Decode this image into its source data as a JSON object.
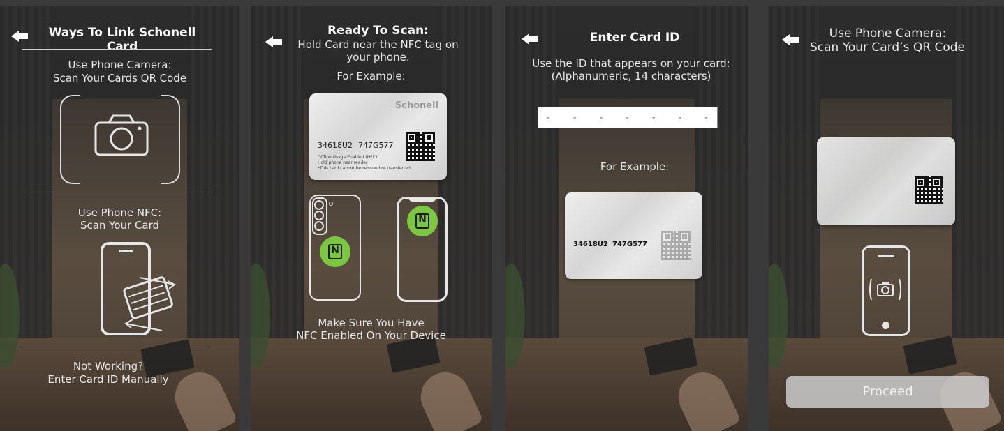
{
  "panel1": {
    "title": "Ways To Link Schonell Card",
    "camera_line1": "Use Phone Camera:",
    "camera_line2": "Scan Your Cards QR Code",
    "nfc_line1": "Use Phone NFC:",
    "nfc_line2": "Scan Your Card",
    "manual_line1": "Not Working?",
    "manual_line2": "Enter Card ID Manually"
  },
  "panel2": {
    "title": "Ready To Scan:",
    "subtitle_line1": "Hold Card near the NFC tag on",
    "subtitle_line2": "your phone.",
    "example": "For Example:",
    "footer_line1": "Make Sure You Have",
    "footer_line2": "NFC Enabled On Your Device"
  },
  "panel3": {
    "title": "Enter Card ID",
    "line1": "Use the ID that appears on your card:",
    "line2": "(Alphanumeric, 14 characters)",
    "id_placeholder": "-   -   -   -   -   -   -",
    "example": "For Example:"
  },
  "panel4": {
    "title_line1": "Use Phone Camera:",
    "title_line2": "Scan Your Card’s QR Code",
    "proceed": "Proceed"
  },
  "card": {
    "brand": "Schonell",
    "id_part1": "34618U2",
    "id_part2": "747G577",
    "fine1": "Offline Usage Enabled (NFC)",
    "fine2": "Hold phone near reader",
    "fine3": "*This card cannot be reissued or transferred"
  },
  "icons": {
    "back": "back-arrow-icon",
    "camera": "camera-icon",
    "phone": "phone-icon",
    "nfc": "nfc-icon"
  },
  "colors": {
    "nfc_green": "#7cc642",
    "background": "#3a3a3a"
  }
}
